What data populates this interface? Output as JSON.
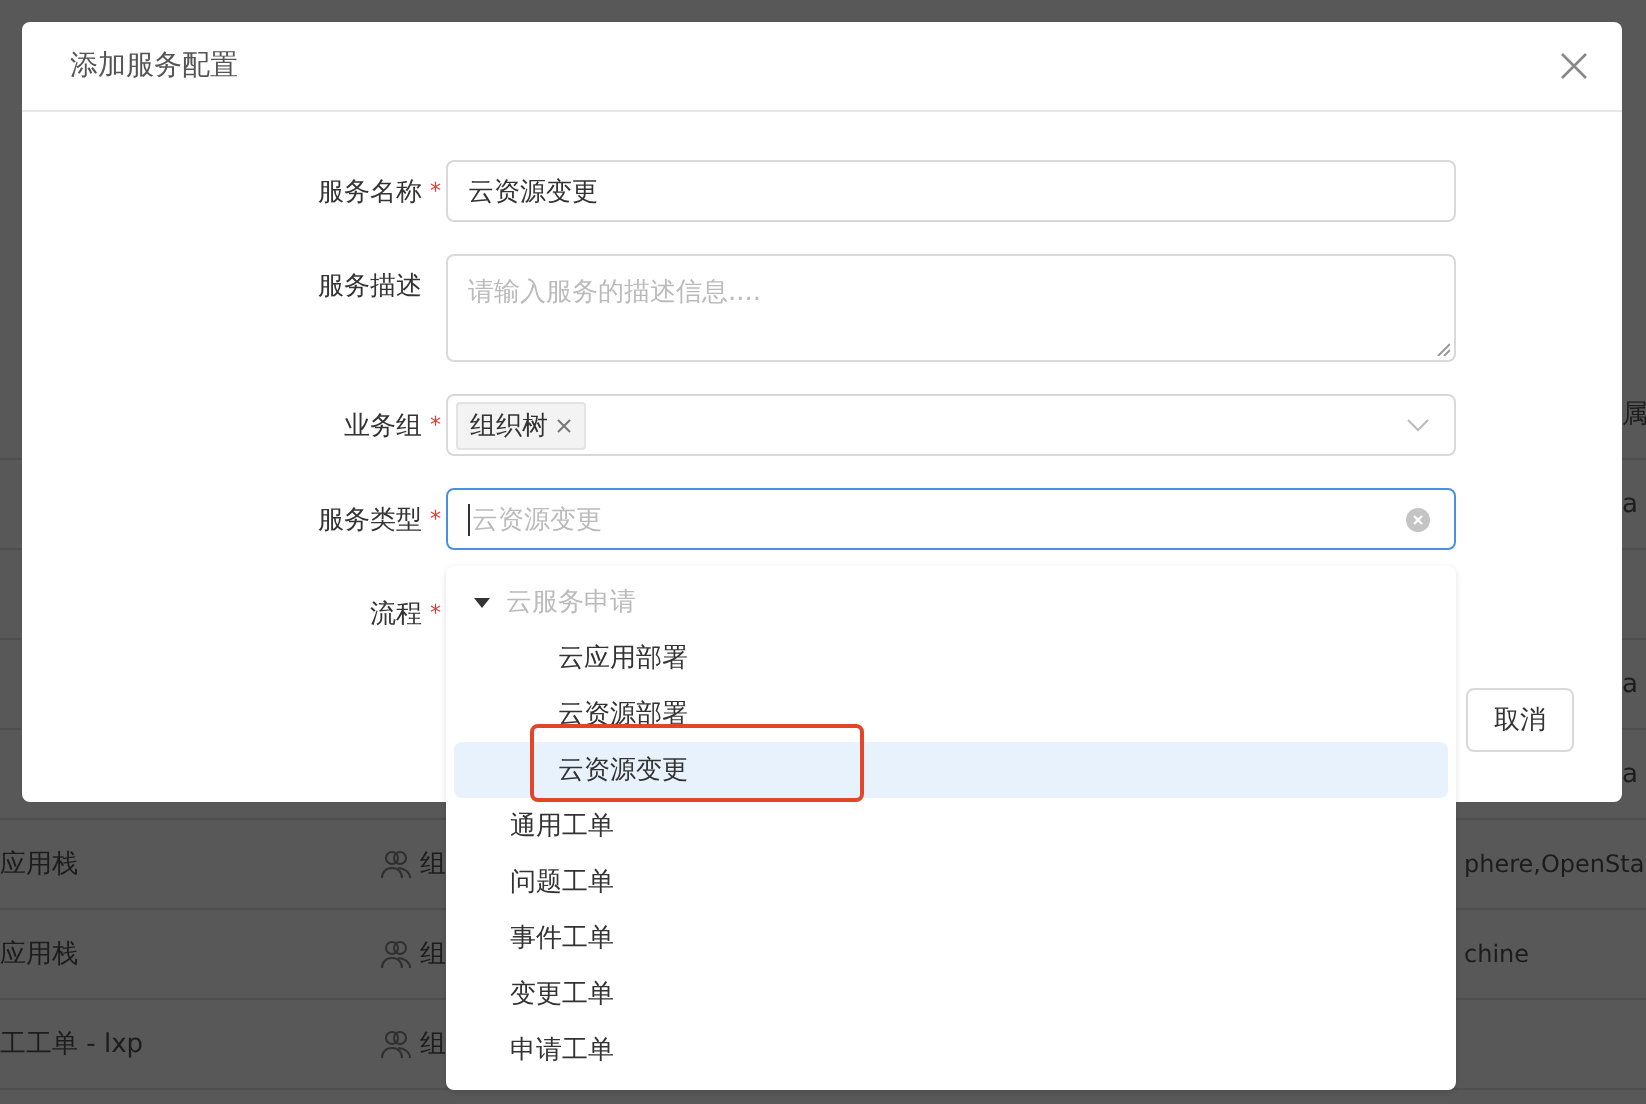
{
  "background_table": {
    "rows": [
      {
        "column_4": "属"
      },
      {
        "column_4": "a"
      },
      {},
      {
        "column_4": "a"
      },
      {
        "column_4": "a"
      },
      {
        "name": "应用栈",
        "group": "组",
        "column_3": "phere,OpenSta"
      },
      {
        "name": "应用栈",
        "group": "组",
        "column_3": "chine"
      },
      {
        "name": "工工单 - lxp",
        "group": "组"
      }
    ]
  },
  "dialog": {
    "title": "添加服务配置",
    "fields": [
      {
        "kind": "input",
        "label": "服务名称",
        "required_mark": "*",
        "value": "云资源变更"
      },
      {
        "kind": "textarea",
        "label": "服务描述",
        "placeholder": "请输入服务的描述信息...."
      },
      {
        "kind": "tags",
        "label": "业务组",
        "required_mark": "*",
        "tags": [
          "组织树"
        ]
      },
      {
        "kind": "select",
        "label": "服务类型",
        "required_mark": "*",
        "placeholder": "云资源变更",
        "focused": true
      },
      {
        "kind": "none",
        "label": "流程",
        "required_mark": "*"
      }
    ],
    "buttons": [
      "取消"
    ]
  },
  "dropdown": {
    "items": [
      {
        "label": "云服务申请",
        "expanded": true,
        "disabled": true,
        "selected": false,
        "children": [
          {
            "label": "云应用部署",
            "selected": false,
            "annotated": false
          },
          {
            "label": "云资源部署",
            "selected": false,
            "annotated": false
          },
          {
            "label": "云资源变更",
            "selected": true,
            "annotated": true
          }
        ]
      },
      {
        "label": "通用工单",
        "selected": false
      },
      {
        "label": "问题工单",
        "selected": false
      },
      {
        "label": "事件工单",
        "selected": false
      },
      {
        "label": "变更工单",
        "selected": false
      },
      {
        "label": "申请工单",
        "selected": false
      }
    ]
  }
}
